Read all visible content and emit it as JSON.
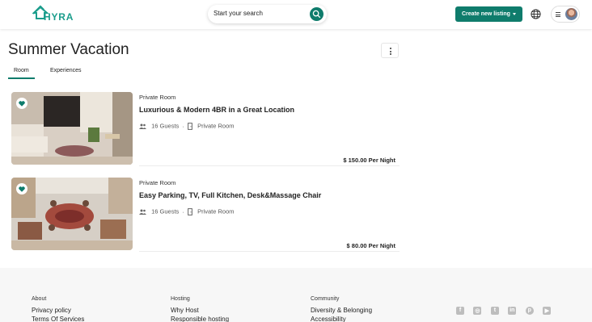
{
  "header": {
    "logo_text": "HYRA",
    "search_placeholder": "Start your search",
    "create_listing_label": "Create new listing"
  },
  "page": {
    "title": "Summer Vacation",
    "tabs": [
      {
        "label": "Room",
        "active": true
      },
      {
        "label": "Experiences",
        "active": false
      }
    ]
  },
  "listings": [
    {
      "type": "Private Room",
      "name": "Luxurious & Modern 4BR in a Great Location",
      "guests": "16 Guests",
      "room": "Private Room",
      "price": "$ 150.00 Per Night",
      "favorited": true
    },
    {
      "type": "Private Room",
      "name": "Easy Parking, TV, Full Kitchen, Desk&Massage Chair",
      "guests": "16 Guests",
      "room": "Private Room",
      "price": "$ 80.00 Per Night",
      "favorited": true
    }
  ],
  "footer": {
    "columns": [
      {
        "heading": "About",
        "links": [
          "Privacy policy",
          "Terms Of Services"
        ]
      },
      {
        "heading": "Hosting",
        "links": [
          "Why Host",
          "Responsible hosting"
        ]
      },
      {
        "heading": "Community",
        "links": [
          "Diversity & Belonging",
          "Accessibility"
        ]
      }
    ],
    "social_icons": [
      "facebook-icon",
      "instagram-icon",
      "twitter-icon",
      "linkedin-icon",
      "pinterest-icon",
      "youtube-icon"
    ]
  },
  "colors": {
    "brand": "#0f7c6c",
    "logo": "#1b9d8c"
  }
}
